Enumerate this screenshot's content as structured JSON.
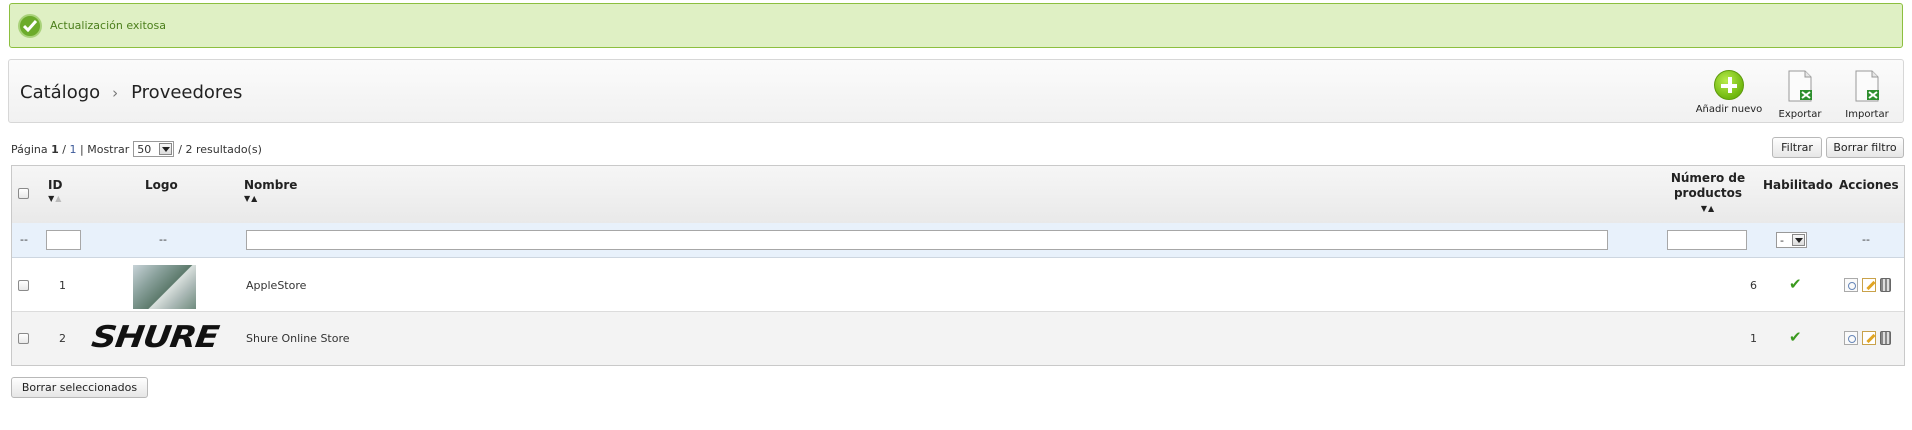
{
  "alert": {
    "message": "Actualización exitosa",
    "icon": "check-circle-icon"
  },
  "breadcrumb": {
    "section": "Catálogo",
    "separator": "›",
    "page": "Proveedores"
  },
  "toolbar": {
    "add_label": "Añadir nuevo",
    "export_label": "Exportar",
    "import_label": "Importar"
  },
  "pager": {
    "prefix": "Página",
    "current": "1",
    "slash": "/",
    "total": "1",
    "show_label": "| Mostrar",
    "per_page": "50",
    "results": "/ 2 resultado(s)"
  },
  "buttons": {
    "filter": "Filtrar",
    "clear_filter": "Borrar filtro",
    "delete_selected": "Borrar seleccionados"
  },
  "table": {
    "columns": {
      "id": "ID",
      "logo": "Logo",
      "name": "Nombre",
      "products_line1": "Número de",
      "products_line2": "productos",
      "enabled": "Habilitado",
      "actions": "Acciones"
    },
    "filters": {
      "first": "--",
      "logo": "--",
      "enabled": "-",
      "actions": "--"
    },
    "rows": [
      {
        "id": "1",
        "logo": "applestore-photo",
        "name": "AppleStore",
        "products": "6",
        "enabled": "✔"
      },
      {
        "id": "2",
        "logo": "SHURE",
        "name": "Shure Online Store",
        "products": "1",
        "enabled": "✔"
      }
    ]
  },
  "colors": {
    "success_bg": "#dff0c4",
    "success_border": "#8cbf3f",
    "enabled_tick": "#3b9a1f",
    "filter_row": "#e8f1fb"
  }
}
